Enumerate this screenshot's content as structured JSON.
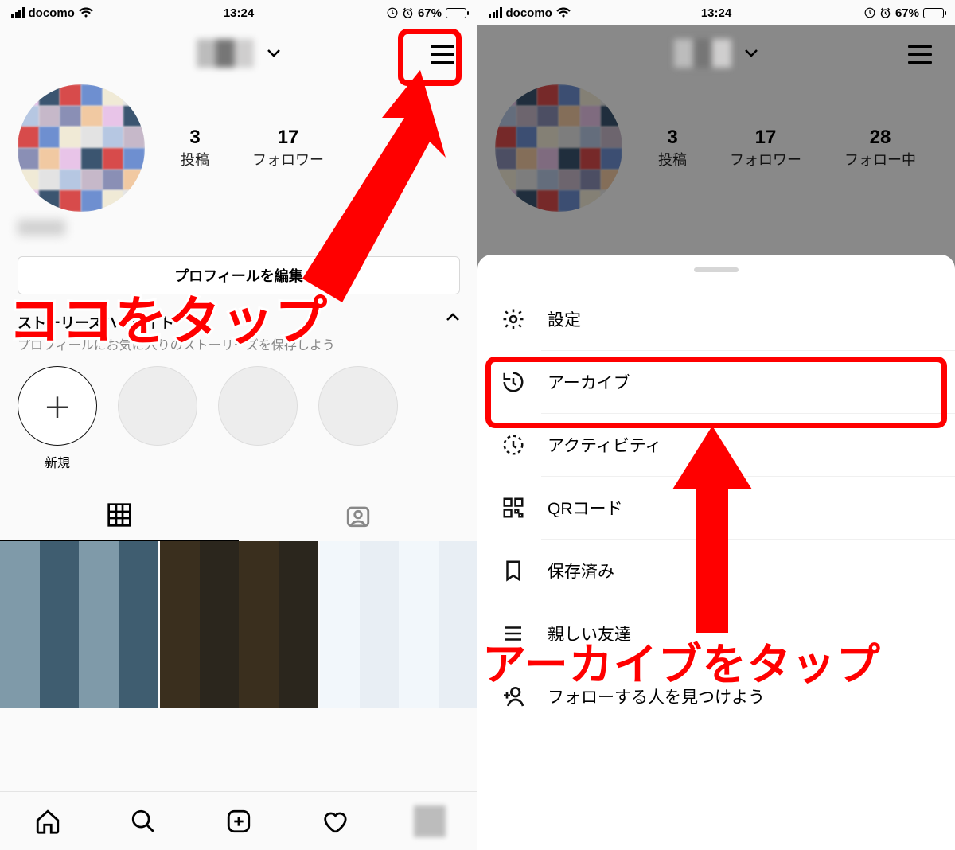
{
  "status": {
    "carrier": "docomo",
    "time": "13:24",
    "battery_pct": "67%"
  },
  "profile": {
    "posts_count": "3",
    "posts_label": "投稿",
    "followers_count": "17",
    "followers_label": "フォロワー",
    "following_count": "28",
    "following_label": "フォロー中",
    "edit_button": "プロフィールを編集",
    "stories_title": "ストーリーズハイライト",
    "stories_sub": "プロフィールにお気に入りのストーリーズを保存しよう",
    "highlight_new": "新規"
  },
  "menu": {
    "settings": "設定",
    "archive": "アーカイブ",
    "activity": "アクティビティ",
    "qrcode": "QRコード",
    "saved": "保存済み",
    "close_friends": "親しい友達",
    "discover": "フォローする人を見つけよう"
  },
  "annotations": {
    "tap_here": "ココをタップ",
    "tap_archive": "アーカイブをタップ"
  }
}
